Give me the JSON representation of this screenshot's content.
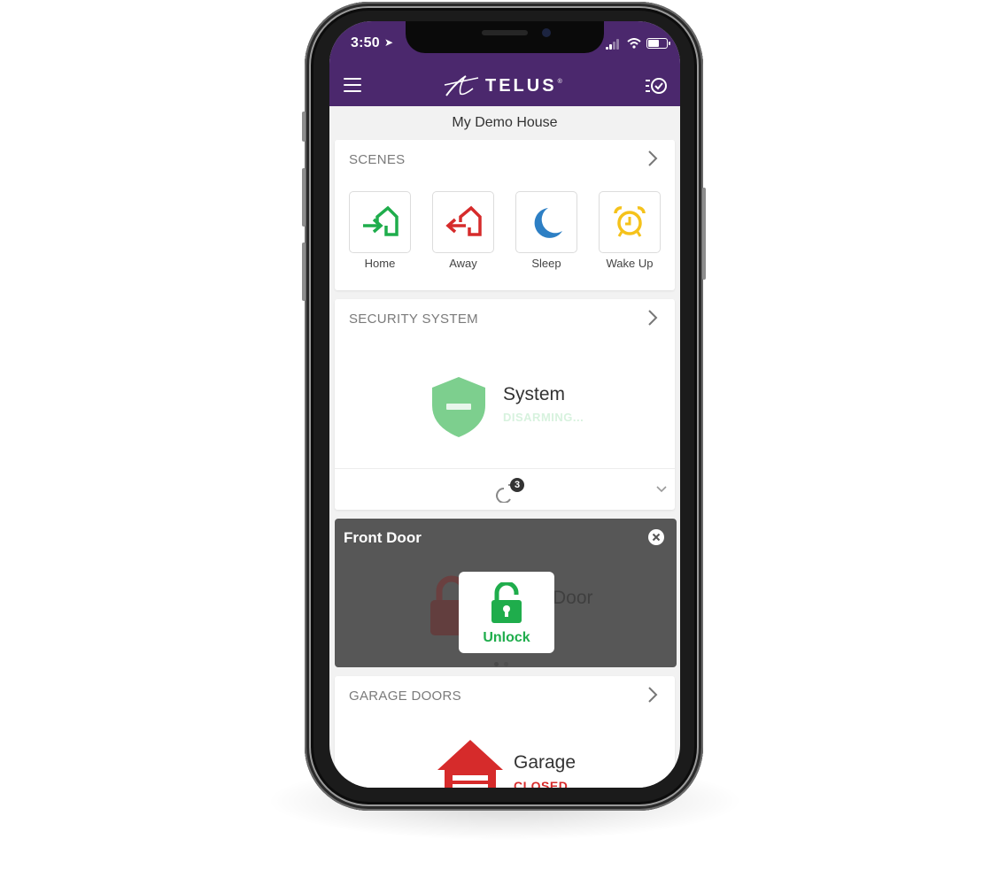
{
  "status_bar": {
    "time": "3:50",
    "location_icon": "location-arrow-icon",
    "signal_icon": "cellular-signal-icon",
    "wifi_icon": "wifi-icon",
    "battery_icon": "battery-icon",
    "battery_level": 0.6
  },
  "app_bar": {
    "menu_icon": "hamburger-menu-icon",
    "brand": "TELUS",
    "brand_mark": "®",
    "tasks_icon": "task-list-check-icon",
    "color": "#4b286d"
  },
  "location": {
    "title": "My Demo House"
  },
  "scenes": {
    "heading": "SCENES",
    "items": [
      {
        "label": "Home",
        "icon": "arrive-home-icon",
        "color": "#1fad4c"
      },
      {
        "label": "Away",
        "icon": "leave-home-icon",
        "color": "#d62b2b"
      },
      {
        "label": "Sleep",
        "icon": "moon-icon",
        "color": "#2d7fc4"
      },
      {
        "label": "Wake Up",
        "icon": "alarm-clock-icon",
        "color": "#f5c21b"
      }
    ]
  },
  "security": {
    "heading": "SECURITY SYSTEM",
    "name": "System",
    "status": "DISARMING...",
    "shield_color": "#7dcf8e",
    "pending_count": "3"
  },
  "lock": {
    "title": "Front Door",
    "behind_text": "Door",
    "action_label": "Unlock",
    "action_color": "#1fad4c"
  },
  "garage": {
    "heading": "GARAGE DOORS",
    "name": "Garage",
    "status": "CLOSED",
    "color": "#d62b2b"
  }
}
